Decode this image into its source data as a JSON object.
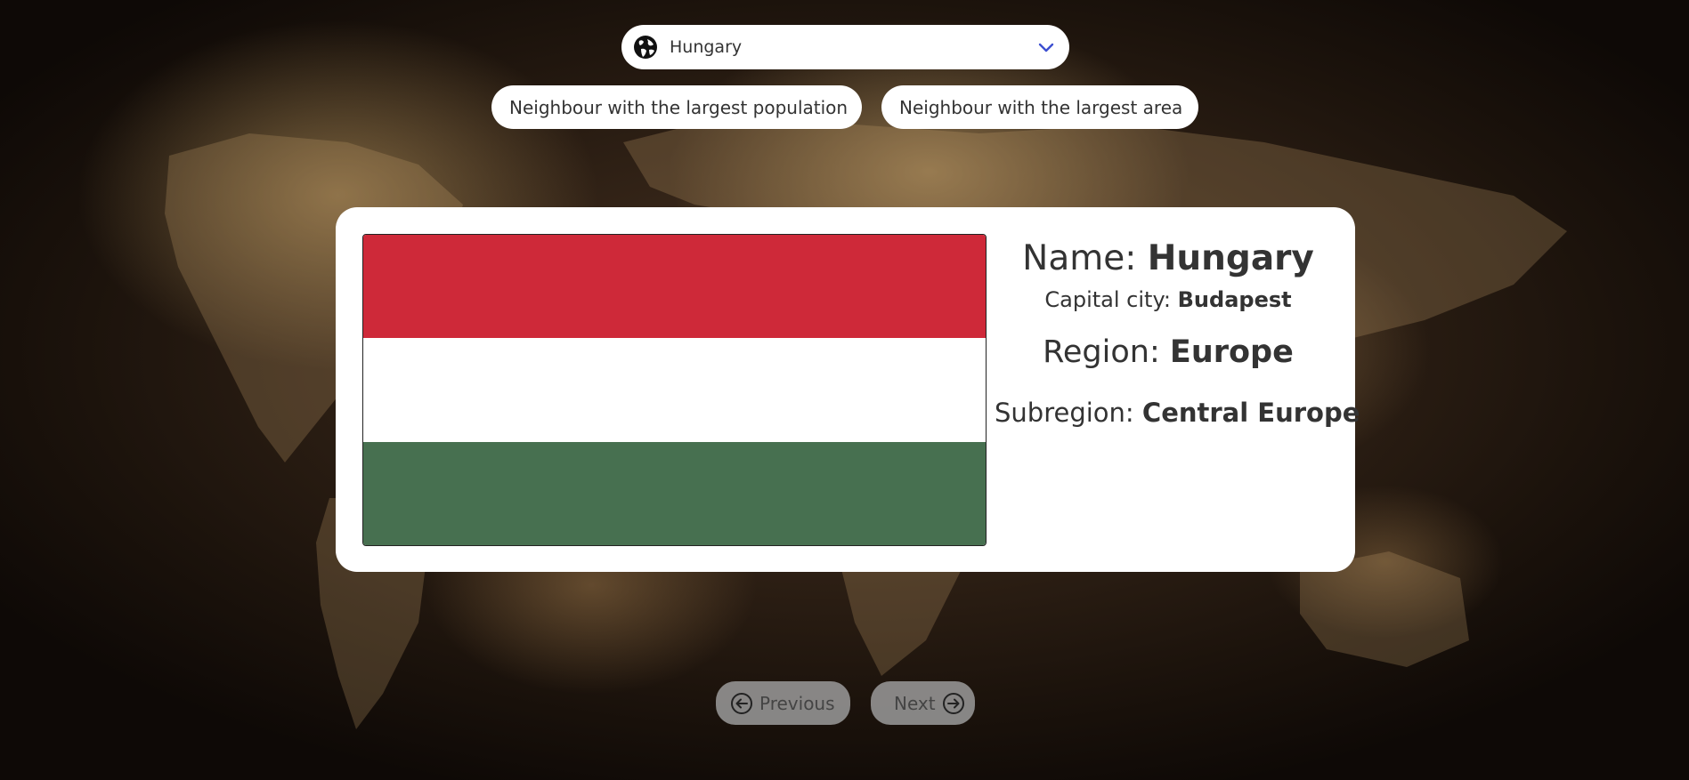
{
  "country_select": {
    "value": "Hungary",
    "icon": "globe-icon",
    "chevron_icon": "chevron-down-icon",
    "chevron_color": "#3d4fd1"
  },
  "neighbour_buttons": {
    "population_label": "Neighbour with the largest population",
    "population_icon": "users-icon",
    "area_label": "Neighbour with the largest area",
    "area_icon": "map-pin-icon"
  },
  "country_card": {
    "flag": {
      "alt": "Flag of Hungary",
      "stripes": [
        "#ce2939",
        "#ffffff",
        "#477050"
      ]
    },
    "name_label": "Name:",
    "name_value": "Hungary",
    "capital_label": "Capital city:",
    "capital_value": "Budapest",
    "region_label": "Region:",
    "region_value": "Europe",
    "subregion_label": "Subregion:",
    "subregion_value": "Central Europe"
  },
  "navigation": {
    "previous_label": "Previous",
    "previous_icon": "arrow-left-circle-icon",
    "next_label": "Next",
    "next_icon": "arrow-right-circle-icon"
  }
}
